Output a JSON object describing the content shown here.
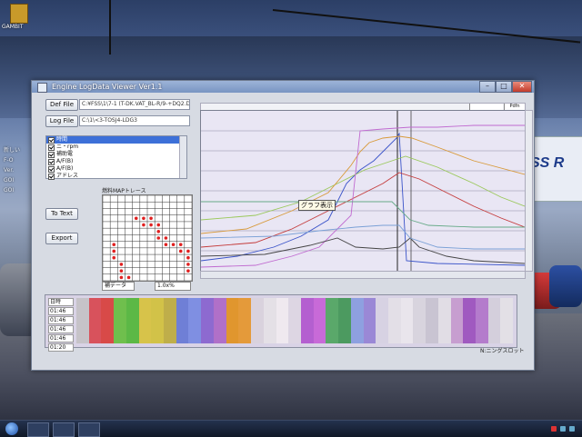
{
  "desktop": {
    "icon_labels": [
      "GAMBIT",
      "",
      ""
    ],
    "side_labels": [
      "新しい",
      "F-O",
      "Ver.",
      "",
      "GOI",
      "",
      "GOI"
    ],
    "sign_text": "SS R",
    "tray_time": "",
    "colors": {
      "sky": "#4a6294",
      "taskbar": "#101827"
    }
  },
  "window": {
    "title": "Engine LogData Viewer  Ver1.1",
    "controls": {
      "minimize": "–",
      "maximize": "□",
      "close": "✕"
    }
  },
  "toolbar": {
    "def_file_button": "Def File",
    "log_file_button": "Log File",
    "def_file_path": "C:¥FSS\\1\\7-1 (T-DK.VAT_BL-R/9-+DQ2.DC",
    "log_file_path": "C:\\1\\<3-TOSJ4-LDG3",
    "to_text_button": "To Text",
    "export_button": "Export"
  },
  "channels": [
    {
      "label": "時間",
      "checked": true,
      "selected": true
    },
    {
      "label": "ニ・rpm",
      "checked": true,
      "selected": false
    },
    {
      "label": "補助電",
      "checked": true,
      "selected": false
    },
    {
      "label": "A/F(B)",
      "checked": true,
      "selected": false
    },
    {
      "label": "A/F(B)",
      "checked": true,
      "selected": false
    },
    {
      "label": "アドレス",
      "checked": true,
      "selected": false
    }
  ],
  "map": {
    "title": "燃料MAPトレース",
    "left_combo": "補データ",
    "right_combo": "1.0x%",
    "grid_cols": 12,
    "grid_rows": 13,
    "points": [
      [
        4,
        3
      ],
      [
        5,
        3
      ],
      [
        6,
        3
      ],
      [
        5,
        4
      ],
      [
        6,
        4
      ],
      [
        7,
        4
      ],
      [
        7,
        5
      ],
      [
        7,
        6
      ],
      [
        8,
        6
      ],
      [
        8,
        7
      ],
      [
        9,
        7
      ],
      [
        10,
        7
      ],
      [
        10,
        8
      ],
      [
        11,
        8
      ],
      [
        11,
        9
      ],
      [
        11,
        10
      ],
      [
        11,
        11
      ],
      [
        1,
        7
      ],
      [
        1,
        8
      ],
      [
        1,
        9
      ],
      [
        2,
        10
      ],
      [
        2,
        11
      ],
      [
        2,
        12
      ],
      [
        3,
        12
      ]
    ]
  },
  "graph": {
    "tooltip": "グラフ表示",
    "top_combo_right": "Pdfn",
    "series_colors": [
      "#3a53c9",
      "#c43b3b",
      "#d89a3a",
      "#9ac85a",
      "#7aa0d6",
      "#c06ad0",
      "#444444",
      "#66aa88"
    ]
  },
  "bottom": {
    "row_labels": [
      "日時",
      "01:46",
      "01:46",
      "01:46",
      "01:46",
      "01:20"
    ],
    "color_bands": [
      "#c6c3c8",
      "#d8525c",
      "#d84a48",
      "#6fbf4d",
      "#5cb846",
      "#d7c34a",
      "#d2c248",
      "#bfae4a",
      "#6f7fd6",
      "#7f8fe2",
      "#8d6ad0",
      "#b070c8",
      "#e0962e",
      "#e49a3a",
      "#d9d2dd",
      "#e4e0e6",
      "#efe9ef",
      "#ddd6e3",
      "#b45fd0",
      "#c86ad8",
      "#5aa86a",
      "#4c9a60",
      "#8ea0e0",
      "#9a88d6",
      "#d7d2e3",
      "#e3dfe7",
      "#e9e5ec",
      "#d8d4de",
      "#c9c4d2",
      "#e1dde5",
      "#c79ed0",
      "#a05ac0",
      "#b47ccc",
      "#d4cfdc",
      "#e3e0e6"
    ]
  },
  "status": "N:ニングスロット"
}
